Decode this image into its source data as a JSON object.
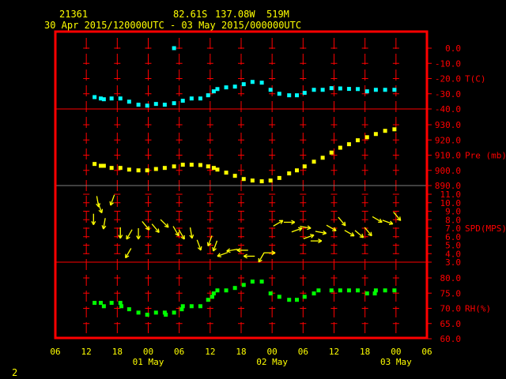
{
  "header": {
    "station_id": "21361",
    "latitude": "82.61S",
    "longitude": "137.08W",
    "elevation": "519M",
    "time_range": "30 Apr 2015/120000UTC - 03 May 2015/000000UTC"
  },
  "footer": {
    "frame_number": "2"
  },
  "colors": {
    "frame": "#ff0000",
    "axis_text": "#ff0000",
    "time_text": "#ffff00",
    "temperature": "#00ffff",
    "pressure": "#ffff00",
    "wind": "#ffff00",
    "rh": "#00ff00"
  },
  "chart_data": {
    "type": "scatter",
    "title": "21361 82.61S 137.08W 519M",
    "subtitle": "30 Apr 2015/120000UTC - 03 May 2015/000000UTC",
    "x_units": "hours since 30 Apr 2015 06UTC",
    "xlim": [
      0,
      72
    ],
    "x_ticks": [
      "06",
      "12",
      "18",
      "00",
      "06",
      "12",
      "18",
      "00",
      "06",
      "12",
      "18",
      "00",
      "06"
    ],
    "date_labels": [
      {
        "label": "01 May",
        "hour": 18
      },
      {
        "label": "02 May",
        "hour": 42
      },
      {
        "label": "03 May",
        "hour": 66
      }
    ],
    "panels": [
      {
        "id": "temperature",
        "label": "T(C)",
        "ylim": [
          -40,
          0
        ],
        "tick_values": [
          0,
          -10,
          -20,
          -30,
          -40
        ],
        "tick_labels": [
          "0.0",
          "-10.0",
          "-20.0",
          "-30.0",
          "-40.0"
        ],
        "points": [
          [
            7.6,
            -32.2
          ],
          [
            8.8,
            -33.1
          ],
          [
            9.4,
            -33.6
          ],
          [
            10.9,
            -33.1
          ],
          [
            12.6,
            -33.1
          ],
          [
            14.3,
            -35.2
          ],
          [
            16.1,
            -37.2
          ],
          [
            17.8,
            -37.8
          ],
          [
            19.5,
            -36.7
          ],
          [
            21.2,
            -37.2
          ],
          [
            23.0,
            -36.2
          ],
          [
            23.0,
            0.0
          ],
          [
            24.7,
            -34.6
          ],
          [
            26.4,
            -33.1
          ],
          [
            28.1,
            -33.1
          ],
          [
            29.6,
            -31.0
          ],
          [
            30.7,
            -28.4
          ],
          [
            31.4,
            -26.9
          ],
          [
            33.1,
            -25.8
          ],
          [
            34.8,
            -25.3
          ],
          [
            36.5,
            -23.7
          ],
          [
            38.2,
            -22.2
          ],
          [
            40.0,
            -22.7
          ],
          [
            41.7,
            -27.4
          ],
          [
            43.4,
            -30.0
          ],
          [
            45.3,
            -31.0
          ],
          [
            46.8,
            -31.0
          ],
          [
            48.3,
            -29.4
          ],
          [
            50.1,
            -27.4
          ],
          [
            51.8,
            -27.4
          ],
          [
            53.5,
            -26.3
          ],
          [
            55.2,
            -26.5
          ],
          [
            56.9,
            -26.8
          ],
          [
            58.6,
            -26.9
          ],
          [
            60.4,
            -28.4
          ],
          [
            62.1,
            -27.4
          ],
          [
            63.9,
            -27.4
          ],
          [
            65.7,
            -27.4
          ]
        ]
      },
      {
        "id": "pressure",
        "label": "Pre (mb)",
        "ylim": [
          890,
          930
        ],
        "tick_values": [
          930,
          920,
          910,
          900,
          890
        ],
        "tick_labels": [
          "930.0",
          "920.0",
          "910.0",
          "900.0",
          "890.0"
        ],
        "points": [
          [
            7.6,
            904.2
          ],
          [
            8.8,
            903.0
          ],
          [
            9.4,
            903.0
          ],
          [
            10.9,
            901.6
          ],
          [
            12.6,
            901.6
          ],
          [
            14.3,
            900.5
          ],
          [
            16.1,
            900.0
          ],
          [
            17.8,
            900.0
          ],
          [
            19.5,
            900.9
          ],
          [
            21.2,
            901.6
          ],
          [
            23.0,
            902.6
          ],
          [
            24.7,
            903.7
          ],
          [
            26.4,
            903.7
          ],
          [
            28.1,
            903.5
          ],
          [
            29.6,
            902.6
          ],
          [
            30.7,
            901.6
          ],
          [
            31.4,
            900.5
          ],
          [
            33.1,
            898.5
          ],
          [
            34.8,
            896.4
          ],
          [
            36.5,
            894.3
          ],
          [
            38.2,
            893.3
          ],
          [
            40.0,
            892.8
          ],
          [
            41.7,
            893.3
          ],
          [
            43.4,
            895.0
          ],
          [
            45.3,
            898.0
          ],
          [
            46.8,
            900.0
          ],
          [
            48.3,
            902.6
          ],
          [
            50.1,
            905.7
          ],
          [
            51.8,
            908.3
          ],
          [
            53.5,
            911.7
          ],
          [
            55.2,
            914.9
          ],
          [
            56.9,
            917.2
          ],
          [
            58.6,
            919.8
          ],
          [
            60.4,
            921.8
          ],
          [
            62.1,
            923.9
          ],
          [
            63.9,
            926.0
          ],
          [
            65.7,
            927.0
          ]
        ]
      },
      {
        "id": "wind",
        "label": "SPD(MPS)",
        "ylim": [
          3,
          11
        ],
        "tick_values": [
          11,
          10,
          9,
          8,
          7,
          6,
          5,
          4,
          3
        ],
        "tick_labels": [
          "11.0",
          "10.0",
          "9.0",
          "8.0",
          "7.0",
          "6.0",
          "5.0",
          "4.0",
          "3.0"
        ],
        "point_format": [
          "hour",
          "speed_mps",
          "direction_from_deg"
        ],
        "points": [
          [
            8.4,
            9.5,
            350
          ],
          [
            9.0,
            8.8,
            340
          ],
          [
            10.7,
            9.7,
            20
          ],
          [
            7.4,
            7.4,
            0
          ],
          [
            9.3,
            6.9,
            10
          ],
          [
            12.6,
            5.8,
            0
          ],
          [
            13.8,
            5.7,
            30
          ],
          [
            16.1,
            5.7,
            0
          ],
          [
            13.6,
            3.5,
            30
          ],
          [
            18.2,
            6.8,
            320
          ],
          [
            20.1,
            6.5,
            320
          ],
          [
            21.9,
            7.1,
            315
          ],
          [
            23.9,
            6.1,
            330
          ],
          [
            25.0,
            5.7,
            330
          ],
          [
            26.5,
            5.8,
            350
          ],
          [
            28.2,
            4.4,
            340
          ],
          [
            29.6,
            4.9,
            20
          ],
          [
            30.6,
            4.3,
            20
          ],
          [
            31.4,
            3.7,
            70
          ],
          [
            33.2,
            4.3,
            80
          ],
          [
            35.2,
            4.4,
            90
          ],
          [
            36.5,
            3.7,
            90
          ],
          [
            39.4,
            3.0,
            30
          ],
          [
            42.6,
            4.1,
            270
          ],
          [
            44.1,
            7.9,
            240
          ],
          [
            46.4,
            7.7,
            270
          ],
          [
            47.8,
            7.0,
            250
          ],
          [
            49.5,
            7.0,
            280
          ],
          [
            50.1,
            6.2,
            250
          ],
          [
            51.6,
            5.5,
            270
          ],
          [
            52.5,
            6.4,
            280
          ],
          [
            54.4,
            6.7,
            300
          ],
          [
            56.2,
            7.3,
            320
          ],
          [
            57.9,
            6.1,
            300
          ],
          [
            59.7,
            5.9,
            310
          ],
          [
            61.3,
            6.1,
            320
          ],
          [
            63.3,
            7.7,
            300
          ],
          [
            65.4,
            7.5,
            290
          ],
          [
            66.9,
            7.9,
            320
          ]
        ]
      },
      {
        "id": "rh",
        "label": "RH(%)",
        "ylim": [
          60,
          80
        ],
        "tick_values": [
          80,
          75,
          70,
          65,
          60
        ],
        "tick_labels": [
          "80.0",
          "75.0",
          "70.0",
          "65.0",
          "60.0"
        ],
        "points": [
          [
            7.6,
            71.8
          ],
          [
            8.8,
            71.8
          ],
          [
            9.4,
            70.7
          ],
          [
            10.9,
            71.8
          ],
          [
            12.6,
            71.8
          ],
          [
            12.8,
            70.7
          ],
          [
            14.3,
            69.7
          ],
          [
            16.1,
            68.6
          ],
          [
            17.8,
            67.9
          ],
          [
            19.5,
            68.6
          ],
          [
            21.2,
            68.6
          ],
          [
            21.4,
            67.9
          ],
          [
            23.0,
            68.6
          ],
          [
            24.7,
            70.7
          ],
          [
            24.5,
            69.7
          ],
          [
            26.4,
            70.7
          ],
          [
            28.1,
            70.7
          ],
          [
            29.6,
            72.8
          ],
          [
            30.7,
            74.9
          ],
          [
            30.4,
            73.8
          ],
          [
            31.4,
            75.9
          ],
          [
            33.1,
            75.9
          ],
          [
            34.8,
            76.7
          ],
          [
            36.5,
            77.7
          ],
          [
            38.2,
            78.8
          ],
          [
            40.0,
            78.8
          ],
          [
            41.7,
            74.9
          ],
          [
            43.4,
            73.8
          ],
          [
            45.3,
            72.8
          ],
          [
            46.8,
            72.8
          ],
          [
            48.3,
            73.8
          ],
          [
            50.1,
            74.9
          ],
          [
            51.0,
            75.9
          ],
          [
            53.5,
            75.9
          ],
          [
            55.2,
            75.9
          ],
          [
            56.9,
            75.9
          ],
          [
            58.6,
            75.9
          ],
          [
            60.4,
            74.9
          ],
          [
            62.1,
            75.9
          ],
          [
            61.9,
            74.9
          ],
          [
            63.9,
            75.9
          ],
          [
            65.7,
            75.9
          ]
        ]
      }
    ]
  }
}
